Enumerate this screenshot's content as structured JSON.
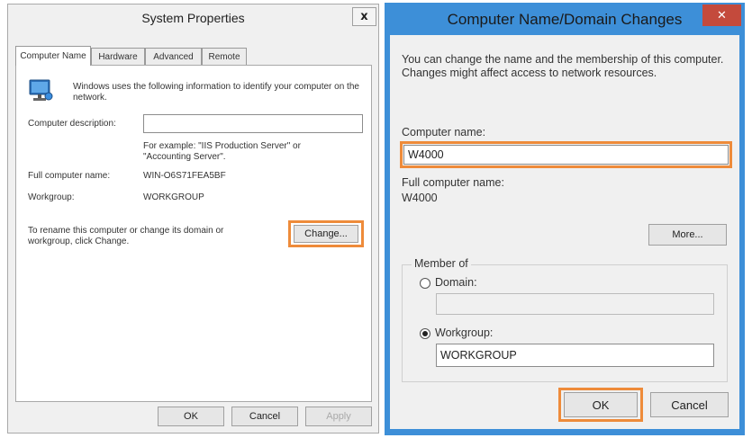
{
  "system_properties": {
    "title": "System Properties",
    "close_glyph": "x",
    "tabs": [
      {
        "label": "Computer Name",
        "active": true
      },
      {
        "label": "Hardware",
        "active": false
      },
      {
        "label": "Advanced",
        "active": false
      },
      {
        "label": "Remote",
        "active": false
      }
    ],
    "intro_text": "Windows uses the following information to identify your computer on the network.",
    "computer_description_label": "Computer description:",
    "computer_description_value": "",
    "example_text": "For example: \"IIS Production Server\" or \"Accounting Server\".",
    "full_computer_name_label": "Full computer name:",
    "full_computer_name_value": "WIN-O6S71FEA5BF",
    "workgroup_label": "Workgroup:",
    "workgroup_value": "WORKGROUP",
    "rename_text": "To rename this computer or change its domain or workgroup, click Change.",
    "change_button": "Change...",
    "ok_button": "OK",
    "cancel_button": "Cancel",
    "apply_button": "Apply"
  },
  "computer_name_dialog": {
    "title": "Computer Name/Domain Changes",
    "close_glyph": "✕",
    "description": "You can change the name and the membership of this computer. Changes might affect access to network resources.",
    "computer_name_label": "Computer name:",
    "computer_name_value": "W4000",
    "full_computer_name_label": "Full computer name:",
    "full_computer_name_value": "W4000",
    "more_button": "More...",
    "member_of_label": "Member of",
    "domain_label": "Domain:",
    "domain_value": "",
    "workgroup_label": "Workgroup:",
    "workgroup_value": "WORKGROUP",
    "selected_membership": "workgroup",
    "ok_button": "OK",
    "cancel_button": "Cancel"
  },
  "colors": {
    "highlight": "#ee8b3a",
    "dialog_frame": "#3d8fd8",
    "close_button": "#c44a3c"
  },
  "icons": {
    "computer": "computer-monitor-icon"
  }
}
